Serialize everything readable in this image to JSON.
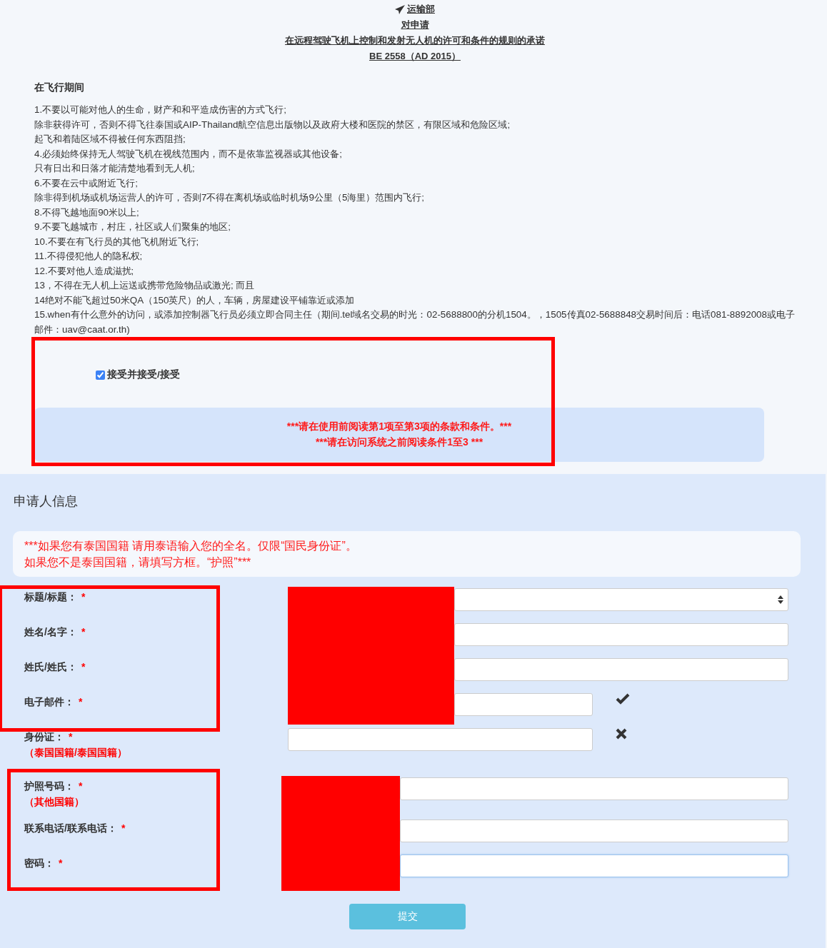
{
  "header": {
    "department": "运输部",
    "lines": [
      "对申请",
      "在远程驾驶飞机上控制和发射无人机的许可和条件的规则的承诺",
      "BE 2558（AD 2015）"
    ]
  },
  "rules": {
    "title": "在飞行期间",
    "items": [
      "1.不要以可能对他人的生命，财产和和平造成伤害的方式飞行;",
      "除非获得许可，否则不得飞往泰国或AIP-Thailand航空信息出版物以及政府大楼和医院的禁区，有限区域和危险区域;",
      "起飞和着陆区域不得被任何东西阻挡;",
      "4.必须始终保持无人驾驶飞机在视线范围内，而不是依靠监视器或其他设备;",
      "只有日出和日落才能清楚地看到无人机;",
      "6.不要在云中或附近飞行;",
      "除非得到机场或机场运营人的许可，否则7不得在离机场或临时机场9公里（5海里）范围内飞行;",
      "8.不得飞越地面90米以上;",
      "9.不要飞越城市，村庄，社区或人们聚集的地区;",
      "10.不要在有飞行员的其他飞机附近飞行;",
      "11.不得侵犯他人的隐私权;",
      "12.不要对他人造成滋扰;",
      "13，不得在无人机上运送或携带危险物品或激光; 而且",
      "14绝对不能飞超过50米QA（150英尺）的人，车辆，房屋建设平铺靠近或添加",
      "15.when有什么意外的访问，或添加控制器飞行员必须立即合同主任（期间.tel域名交易的时光：02-5688800的分机1504。，1505传真02-5688848交易时间后：电话081-8892008或电子邮件：uav@caat.or.th)"
    ]
  },
  "accept": {
    "label": "接受并接受/接受",
    "checked": true,
    "highlighted": true
  },
  "notice": [
    "***请在使用前阅读第1项至第3项的条款和条件。***",
    "***请在访问系统之前阅读条件1至3 ***"
  ],
  "applicant": {
    "title": "申请人信息",
    "hint": [
      "***如果您有泰国国籍 请用泰语输入您的全名。仅限“国民身份证”。",
      "如果您不是泰国国籍，请填写方框。“护照”***"
    ],
    "groups": [
      {
        "highlighted": true,
        "redacted": true,
        "fields": [
          {
            "kind": "select",
            "label": "标题/标题：",
            "mark": "*"
          },
          {
            "kind": "text",
            "label": "姓名/名字：",
            "mark": "*"
          },
          {
            "kind": "text",
            "label": "姓氏/姓氏：",
            "mark": "*"
          },
          {
            "kind": "text",
            "label": "电子邮件：",
            "mark": "*",
            "valid": true
          }
        ]
      },
      {
        "fields": [
          {
            "kind": "text",
            "label": "身份证：",
            "mark": "*",
            "note": "（泰国国籍/泰国国籍）",
            "valid": false
          }
        ]
      },
      {
        "highlighted": true,
        "redacted": true,
        "fields": [
          {
            "kind": "text",
            "label": "护照号码：",
            "mark": "*",
            "note": "（其他国籍）"
          },
          {
            "kind": "text",
            "label": "联系电话/联系电话：",
            "mark": "*"
          },
          {
            "kind": "text",
            "label": "密码：",
            "mark": "*",
            "focused": true
          }
        ]
      }
    ],
    "submit": "提交"
  }
}
